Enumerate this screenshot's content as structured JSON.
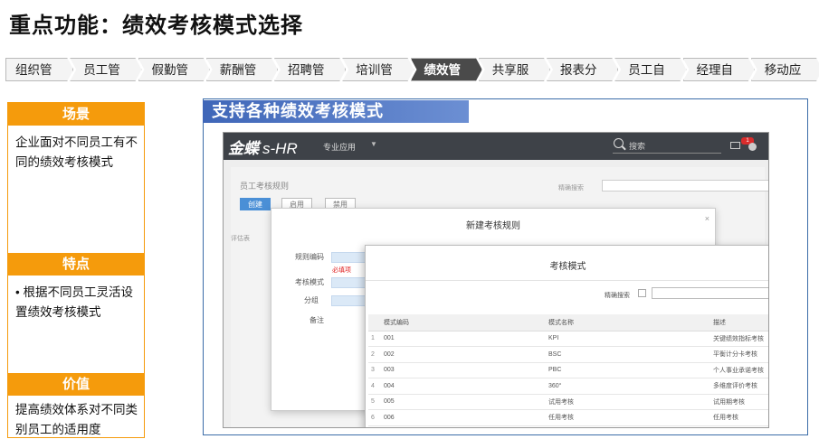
{
  "title": "重点功能：绩效考核模式选择",
  "nav": {
    "items": [
      {
        "label": "组织管理"
      },
      {
        "label": "员工管理"
      },
      {
        "label": "假勤管理"
      },
      {
        "label": "薪酬管理"
      },
      {
        "label": "招聘管理"
      },
      {
        "label": "培训管理"
      },
      {
        "label": "绩效管理",
        "active": true
      },
      {
        "label": "共享服务"
      },
      {
        "label": "报表分析"
      },
      {
        "label": "员工自助"
      },
      {
        "label": "经理自助"
      },
      {
        "label": "移动应用"
      }
    ],
    "active_color": "#4a4a4a"
  },
  "sections": {
    "scene": {
      "heading": "场景",
      "body": "企业面对不同员工有不同的绩效考核模式"
    },
    "feature": {
      "heading": "特点",
      "body": "• 根据不同员工灵活设置绩效考核模式"
    },
    "value": {
      "heading": "价值",
      "body": "提高绩效体系对不同类别员工的适用度"
    },
    "accent_color": "#f59b0c"
  },
  "panel": {
    "title": "支持各种绩效考核模式",
    "app": {
      "brand": "金蝶",
      "product": "s-HR",
      "menu": "专业应用",
      "search_placeholder": "搜索",
      "notify_count": "1"
    },
    "background": {
      "page_title": "员工考核规则",
      "btn_new": "创建",
      "btn_other1": "启用",
      "btn_other2": "禁用",
      "filter_label": "精确搜索",
      "list_label": "评估表"
    },
    "modal": {
      "title": "新建考核规则",
      "close": "×",
      "field_code": "规则编码",
      "field_mode": "考核模式",
      "field_group": "分组",
      "field_note": "备注",
      "required_hint": "必填项"
    },
    "dialog": {
      "title": "考核模式",
      "search_label": "精确搜索",
      "columns": [
        "模式编码",
        "模式名称",
        "描述"
      ],
      "rows": [
        {
          "idx": "1",
          "code": "001",
          "name": "KPI",
          "desc": "关键绩效指标考核"
        },
        {
          "idx": "2",
          "code": "002",
          "name": "BSC",
          "desc": "平衡计分卡考核"
        },
        {
          "idx": "3",
          "code": "003",
          "name": "PBC",
          "desc": "个人事业承诺考核"
        },
        {
          "idx": "4",
          "code": "004",
          "name": "360°",
          "desc": "多维度评价考核"
        },
        {
          "idx": "5",
          "code": "005",
          "name": "试用考核",
          "desc": "试用期考核"
        },
        {
          "idx": "6",
          "code": "006",
          "name": "任用考核",
          "desc": "任用考核"
        }
      ]
    }
  }
}
